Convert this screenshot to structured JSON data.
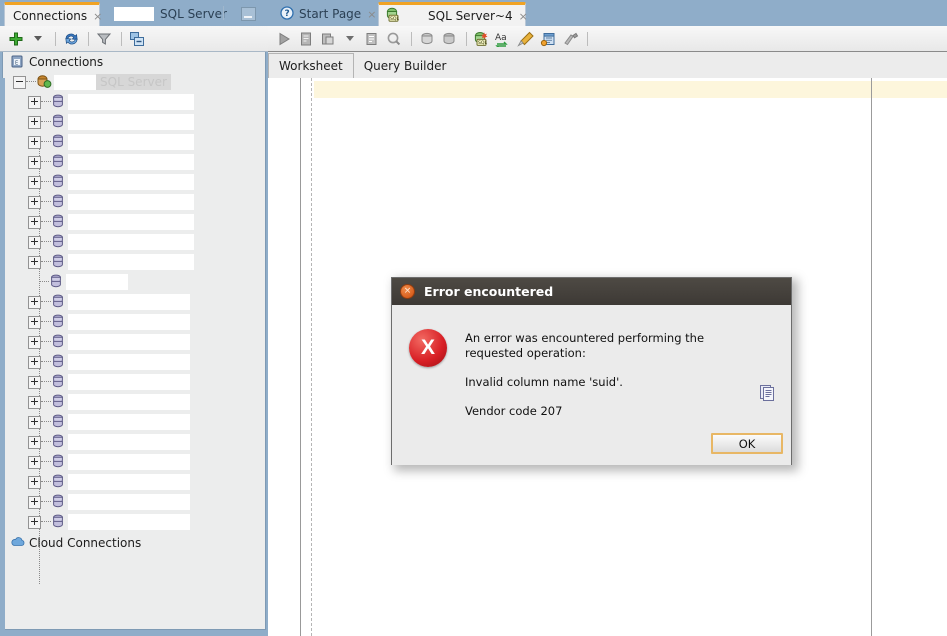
{
  "window": {
    "accent_orange": "#f0a325",
    "titlebar_bg": "#3d3935",
    "panel_bg": "#8fadc9"
  },
  "left_panel": {
    "tabs": [
      {
        "label": "Connections",
        "active": true,
        "closable": true
      },
      {
        "label": "SQL Server",
        "active": false,
        "closable": false,
        "redacted_prefix": true
      }
    ],
    "minimize_button": "minimize-panel",
    "toolbar": [
      {
        "name": "new-connection-icon",
        "glyph": "plus"
      },
      {
        "name": "new-connection-dropdown-icon",
        "glyph": "caret-down"
      },
      {
        "name": "refresh-icon",
        "glyph": "refresh"
      },
      {
        "name": "filter-icon",
        "glyph": "funnel"
      },
      {
        "name": "collapse-all-icon",
        "glyph": "collapse"
      }
    ],
    "tree": {
      "root_label": "Connections",
      "connection_label": "SQL Server",
      "connection_redacted": true,
      "nodes_group_1": 9,
      "nodes_group_2": 13,
      "cloud_label": "Cloud Connections"
    }
  },
  "right_panel": {
    "tabs": [
      {
        "label": "Start Page",
        "active": false,
        "icon": "help-icon",
        "closable": true
      },
      {
        "label": "SQL Server~4",
        "active": true,
        "icon": "sql-server-icon",
        "closable": true
      }
    ],
    "toolbar": [
      {
        "name": "run-statement-icon",
        "glyph": "play"
      },
      {
        "name": "run-script-icon",
        "glyph": "script"
      },
      {
        "name": "autotrace-icon",
        "glyph": "trace"
      },
      {
        "name": "autotrace-dropdown-icon",
        "glyph": "caret-down"
      },
      {
        "name": "explain-plan-icon",
        "glyph": "plan"
      },
      {
        "name": "sql-history-icon",
        "glyph": "history"
      },
      {
        "name": "commit-icon",
        "glyph": "commit"
      },
      {
        "name": "rollback-icon",
        "glyph": "rollback"
      },
      {
        "name": "unshared-sql-worksheet-icon",
        "glyph": "sqlsheet"
      },
      {
        "name": "to-upper-lower-case-icon",
        "glyph": "Aa"
      },
      {
        "name": "clear-icon",
        "glyph": "eraser"
      },
      {
        "name": "query-builder-icon",
        "glyph": "builder"
      },
      {
        "name": "format-icon",
        "glyph": "format"
      }
    ],
    "worksheet_tabs": [
      {
        "label": "Worksheet",
        "active": true
      },
      {
        "label": "Query Builder",
        "active": false
      }
    ],
    "editor": {
      "content": "",
      "current_line_highlight": true,
      "margin_guide": true
    }
  },
  "dialog": {
    "title": "Error encountered",
    "close_icon": "×",
    "icon_glyph": "X",
    "message_line_1": "An error was encountered performing the requested operation:",
    "message_line_2": "Invalid column name 'suid'.",
    "message_line_3": "Vendor code 207",
    "copy_icon": "copy-to-clipboard-icon",
    "ok_label": "OK"
  }
}
